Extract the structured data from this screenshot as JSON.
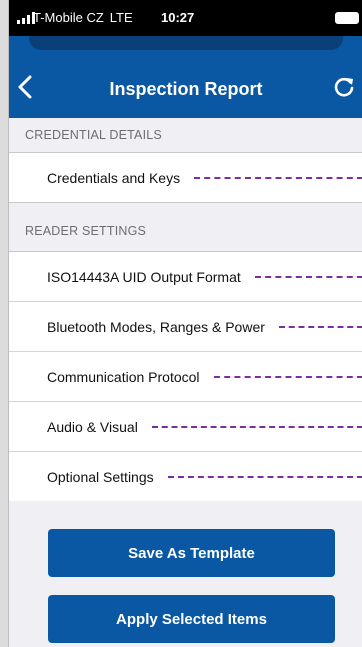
{
  "status_bar": {
    "carrier": "T-Mobile CZ",
    "network": "LTE",
    "time": "10:27"
  },
  "header": {
    "title": "Inspection Report",
    "back_icon": "chevron-left-icon",
    "refresh_icon": "refresh-icon"
  },
  "sections": [
    {
      "title": "CREDENTIAL DETAILS",
      "items": [
        "Credentials and Keys"
      ]
    },
    {
      "title": "READER SETTINGS",
      "items": [
        "ISO14443A UID Output Format",
        "Bluetooth Modes, Ranges & Power",
        "Communication Protocol",
        "Audio & Visual",
        "Optional Settings"
      ]
    }
  ],
  "actions": {
    "save_template": "Save As Template",
    "apply_selected": "Apply Selected Items"
  },
  "colors": {
    "primary": "#0a57a4",
    "dash": "#7a2ea0"
  }
}
